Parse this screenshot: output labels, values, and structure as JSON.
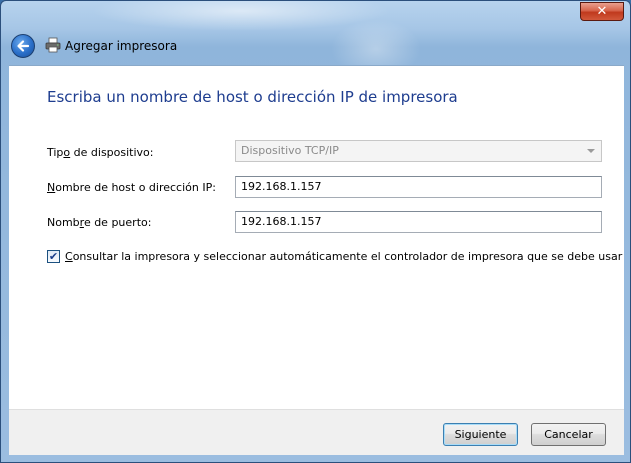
{
  "window": {
    "title": "Agregar impresora",
    "close_symbol": "✕"
  },
  "icons": {
    "back": "back-arrow-icon",
    "printer": "printer-icon",
    "close": "close-icon",
    "check": "checkmark-icon"
  },
  "content": {
    "instruction": "Escriba un nombre de host o dirección IP de impresora",
    "device_type": {
      "label_pre": "Tip",
      "label_accel": "o",
      "label_post": " de dispositivo:",
      "value": "Dispositivo TCP/IP"
    },
    "hostname": {
      "label_accel": "N",
      "label_post": "ombre de host o dirección IP:",
      "value": "192.168.1.157"
    },
    "port": {
      "label_pre": "Nomb",
      "label_accel": "r",
      "label_post": "e de puerto:",
      "value": "192.168.1.157"
    },
    "query_printer": {
      "checked": true,
      "check_mark": "✔",
      "label_accel": "C",
      "label_post": "onsultar la impresora y seleccionar automáticamente el controlador de impresora que se debe usar"
    }
  },
  "footer": {
    "next_label": "Siguiente",
    "cancel_label": "Cancelar"
  },
  "colors": {
    "instruction_text": "#1e3d8f",
    "titlebar": "#9bbde0",
    "close_button": "#c0391d"
  }
}
